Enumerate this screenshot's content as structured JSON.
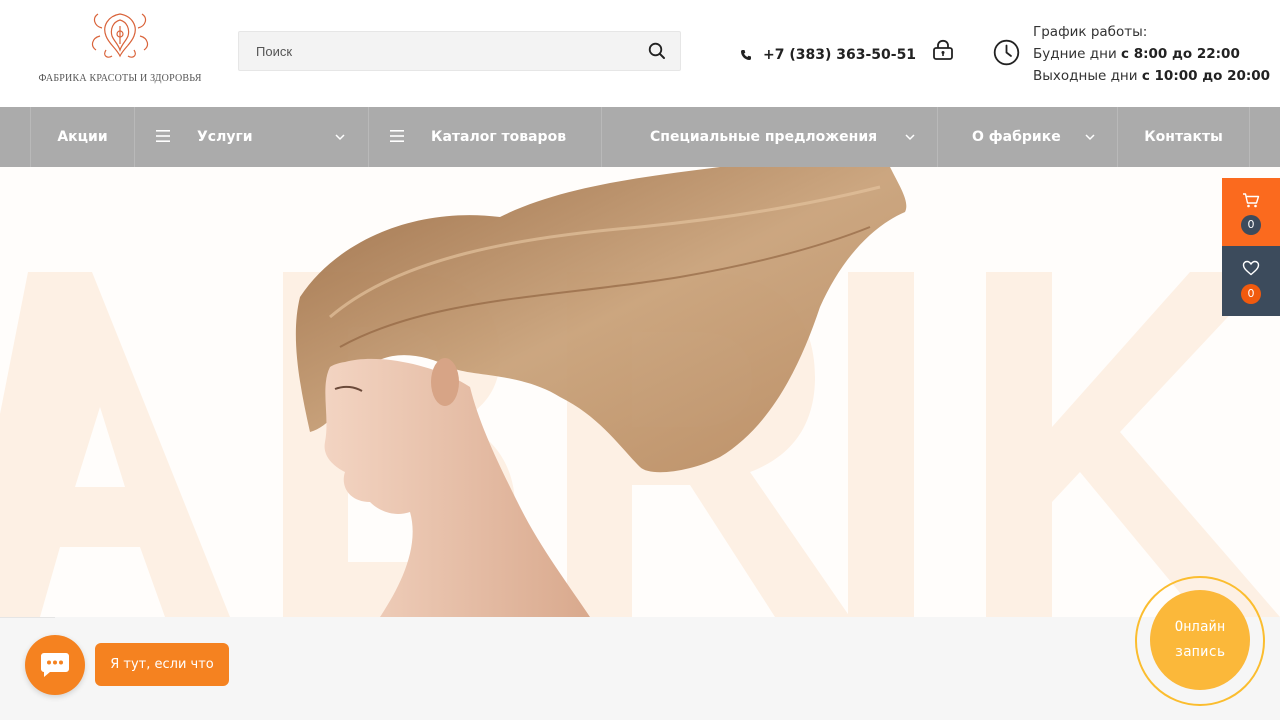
{
  "header": {
    "logo_text": "ФАБРИКА КРАСОТЫ И ЗДОРОВЬЯ",
    "logo_icon": "ornament-logo",
    "search": {
      "placeholder": "Поиск",
      "value": "",
      "icon": "search-icon"
    },
    "phone": {
      "icon": "phone-icon",
      "number": "+7 (383) 363-50-51"
    },
    "login_icon": "lock-icon",
    "schedule": {
      "icon": "clock-icon",
      "title": "График работы:",
      "weekdays_label": "Будние дни",
      "weekdays_time": "с 8:00 до 22:00",
      "weekend_label": "Выходные дни",
      "weekend_time": "с 10:00 до 20:00"
    }
  },
  "nav": {
    "items": [
      {
        "label": "Акции",
        "has_menu_icon": false,
        "has_dropdown": false
      },
      {
        "label": "Услуги",
        "has_menu_icon": true,
        "has_dropdown": true
      },
      {
        "label": "Каталог товаров",
        "has_menu_icon": true,
        "has_dropdown": false
      },
      {
        "label": "Специальные предложения",
        "has_menu_icon": false,
        "has_dropdown": true
      },
      {
        "label": "О фабрике",
        "has_menu_icon": false,
        "has_dropdown": true
      },
      {
        "label": "Контакты",
        "has_menu_icon": false,
        "has_dropdown": false
      }
    ]
  },
  "hero": {
    "background_letters": "ABRIK",
    "image": "woman-profile-with-flowing-hair"
  },
  "side_panel": {
    "cart": {
      "icon": "cart-icon",
      "count": "0"
    },
    "favorites": {
      "icon": "heart-icon",
      "count": "0"
    }
  },
  "chat": {
    "icon": "chat-bubble-icon",
    "tooltip": "Я тут, если что"
  },
  "booking": {
    "line1": "Онлайн",
    "line2": "запись"
  },
  "colors": {
    "accent_orange": "#f58220",
    "cart_orange": "#fb6a1e",
    "dark_slate": "#3c4b5c",
    "nav_gray": "#ababab",
    "booking_yellow": "#fbb83a",
    "hero_letters": "#fdf0e4"
  }
}
